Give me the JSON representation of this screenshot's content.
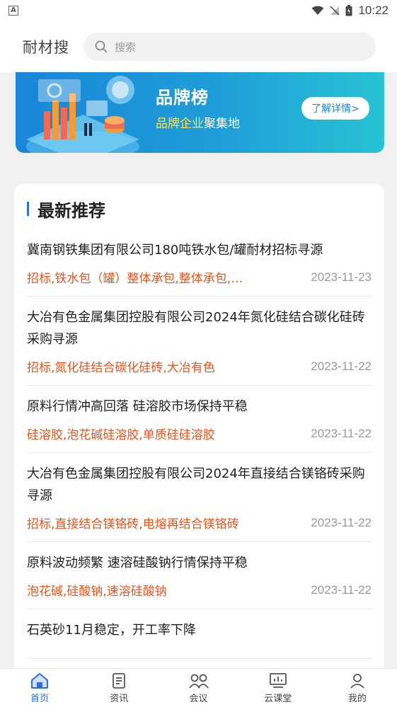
{
  "status": {
    "time": "10:22",
    "indicator": "A"
  },
  "header": {
    "brand": "耐材搜",
    "search_placeholder": "搜索"
  },
  "banner": {
    "title": "品牌榜",
    "subtitle_highlight": "品牌企业",
    "subtitle_rest": "聚集地",
    "button_label": "了解详情>"
  },
  "section": {
    "title": "最新推荐"
  },
  "items": [
    {
      "title": "冀南钢铁集团有限公司180吨铁水包/罐耐材招标寻源",
      "tags": "招标,铁水包（罐）整体承包,整体承包,…",
      "date": "2023-11-23"
    },
    {
      "title": "大冶有色金属集团控股有限公司2024年氮化硅结合碳化硅砖采购寻源",
      "tags": "招标,氮化硅结合碳化硅砖,大冶有色",
      "date": "2023-11-22"
    },
    {
      "title": "原料行情冲高回落 硅溶胶市场保持平稳",
      "tags": "硅溶胶,泡花碱硅溶胶,单质硅硅溶胶",
      "date": "2023-11-22"
    },
    {
      "title": "大冶有色金属集团控股有限公司2024年直接结合镁铬砖采购寻源",
      "tags": "招标,直接结合镁铬砖,电熔再结合镁铬砖",
      "date": "2023-11-22"
    },
    {
      "title": "原料波动频繁 速溶硅酸钠行情保持平稳",
      "tags": "泡花碱,硅酸钠,速溶硅酸钠",
      "date": "2023-11-22"
    },
    {
      "title": "石英砂11月稳定，开工率下降",
      "tags": "",
      "date": ""
    }
  ],
  "tabs": [
    {
      "label": "首页",
      "icon": "home-icon",
      "active": true
    },
    {
      "label": "资讯",
      "icon": "news-icon",
      "active": false
    },
    {
      "label": "会议",
      "icon": "meeting-icon",
      "active": false
    },
    {
      "label": "云课堂",
      "icon": "classroom-icon",
      "active": false
    },
    {
      "label": "我的",
      "icon": "profile-icon",
      "active": false
    }
  ],
  "colors": {
    "accent": "#2f6fd8",
    "tag": "#e8541c",
    "banner_start": "#1a86d9",
    "banner_end": "#27c2d4"
  }
}
